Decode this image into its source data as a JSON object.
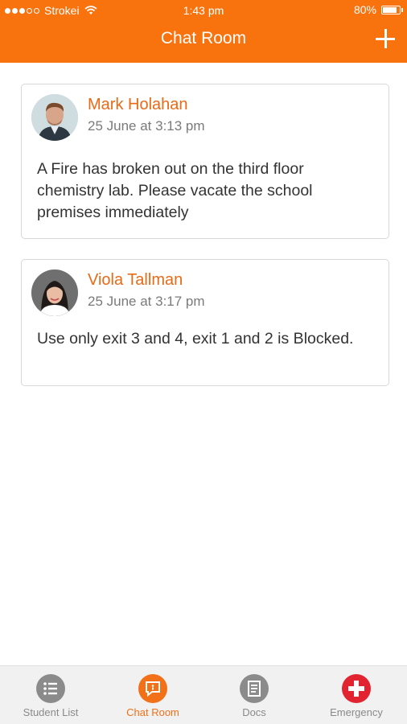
{
  "status_bar": {
    "carrier": "Strokei",
    "time": "1:43 pm",
    "battery": "80%",
    "battery_level": 0.8
  },
  "header": {
    "title": "Chat Room"
  },
  "messages": [
    {
      "author": "Mark Holahan",
      "timestamp": "25 June at 3:13 pm",
      "text": "A Fire has broken out on the third floor chemistry lab. Please vacate the school premises immediately"
    },
    {
      "author": "Viola Tallman",
      "timestamp": "25 June at 3:17 pm",
      "text": "Use only exit 3 and 4, exit 1 and 2 is Blocked."
    }
  ],
  "tabs": [
    {
      "label": "Student List",
      "icon": "list-icon"
    },
    {
      "label": "Chat Room",
      "icon": "chat-icon",
      "active": true
    },
    {
      "label": "Docs",
      "icon": "document-icon"
    },
    {
      "label": "Emergency",
      "icon": "emergency-cross-icon"
    }
  ],
  "colors": {
    "accent": "#f8720e",
    "name": "#e96a16",
    "emergency": "#e1242f"
  }
}
